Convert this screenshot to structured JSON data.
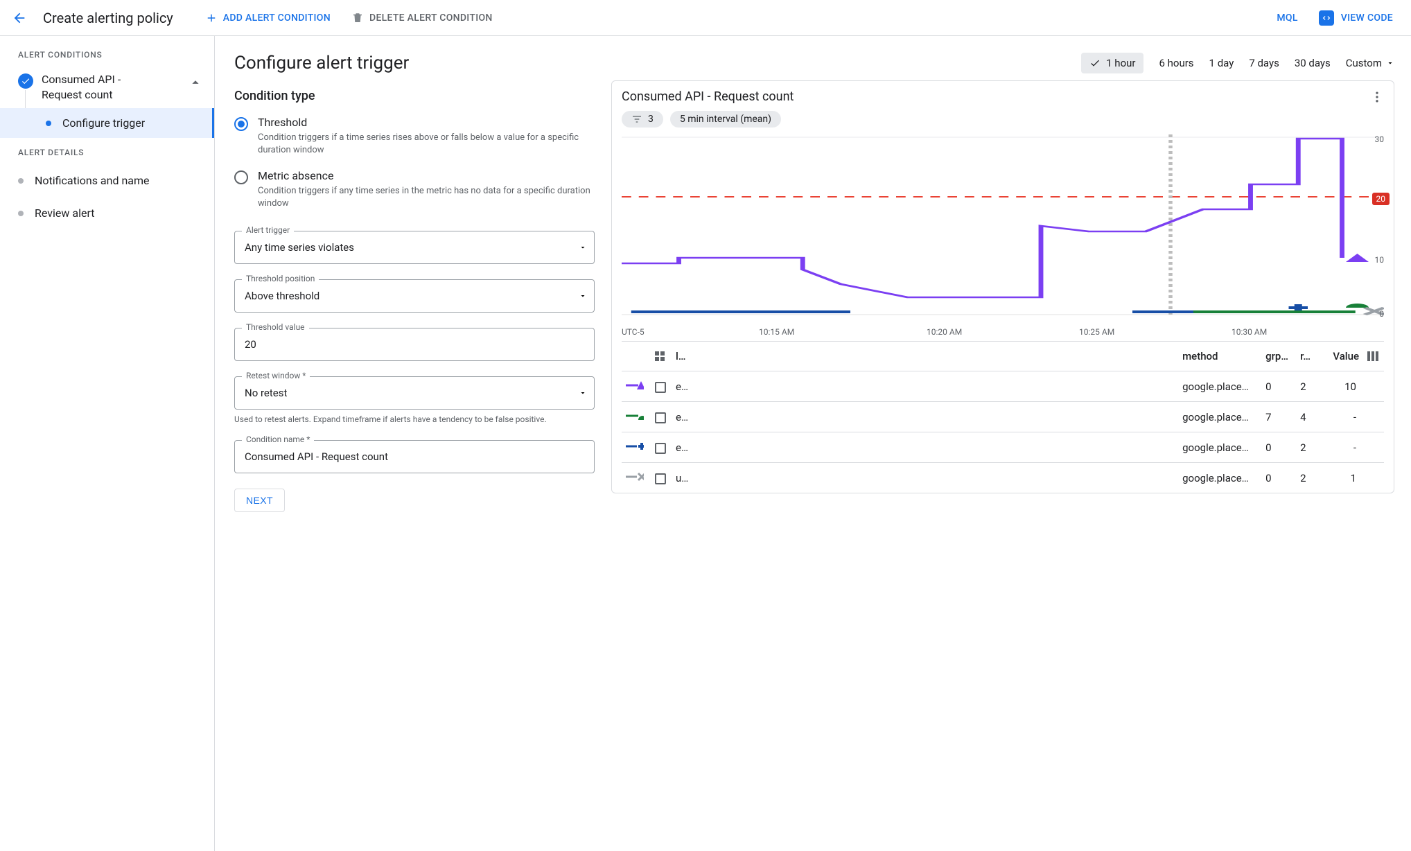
{
  "topbar": {
    "title": "Create alerting policy",
    "add_condition": "ADD ALERT CONDITION",
    "delete_condition": "DELETE ALERT CONDITION",
    "mql": "MQL",
    "view_code": "VIEW CODE"
  },
  "sidebar": {
    "section_conditions": "ALERT CONDITIONS",
    "condition_title_l1": "Consumed API -",
    "condition_title_l2": "Request count",
    "substep": "Configure trigger",
    "section_details": "ALERT DETAILS",
    "detail_notifications": "Notifications and name",
    "detail_review": "Review alert"
  },
  "form": {
    "heading": "Configure alert trigger",
    "cond_type_label": "Condition type",
    "threshold_title": "Threshold",
    "threshold_desc": "Condition triggers if a time series rises above or falls below a value for a specific duration window",
    "absence_title": "Metric absence",
    "absence_desc": "Condition triggers if any time series in the metric has no data for a specific duration window",
    "alert_trigger_label": "Alert trigger",
    "alert_trigger_value": "Any time series violates",
    "threshold_position_label": "Threshold position",
    "threshold_position_value": "Above threshold",
    "threshold_value_label": "Threshold value",
    "threshold_value_value": "20",
    "retest_label": "Retest window *",
    "retest_value": "No retest",
    "retest_helper": "Used to retest alerts. Expand timeframe if alerts have a tendency to be false positive.",
    "cond_name_label": "Condition name *",
    "cond_name_value": "Consumed API - Request count",
    "next": "NEXT"
  },
  "timerange": {
    "selected": "1 hour",
    "r2": "6 hours",
    "r3": "1 day",
    "r4": "7 days",
    "r5": "30 days",
    "custom": "Custom"
  },
  "card": {
    "title": "Consumed API - Request count",
    "filter_count": "3",
    "interval_chip": "5 min interval (mean)",
    "threshold_value": "20",
    "y30": "30",
    "y20": "20",
    "y10": "10",
    "y0": "0",
    "tz": "UTC-5",
    "x1": "10:15 AM",
    "x2": "10:20 AM",
    "x3": "10:25 AM",
    "x4": "10:30 AM"
  },
  "table": {
    "col_l": "l…",
    "col_method": "method",
    "col_grp": "grp…",
    "col_r": "r…",
    "col_value": "Value",
    "rows": [
      {
        "mark": "purple-tri",
        "l": "e…",
        "method": "google.place…",
        "grp": "0",
        "r": "2",
        "value": "10"
      },
      {
        "mark": "green-semi",
        "l": "e…",
        "method": "google.place…",
        "grp": "7",
        "r": "4",
        "value": "-"
      },
      {
        "mark": "blue-plus",
        "l": "e…",
        "method": "google.place…",
        "grp": "0",
        "r": "2",
        "value": "-"
      },
      {
        "mark": "grey-x",
        "l": "u…",
        "method": "google.place…",
        "grp": "0",
        "r": "2",
        "value": "1"
      }
    ]
  },
  "chart_data": {
    "type": "line",
    "title": "Consumed API - Request count",
    "ylabel": "",
    "ylim": [
      0,
      30
    ],
    "threshold": 20,
    "x": [
      "10:10",
      "10:11",
      "10:12",
      "10:13",
      "10:14",
      "10:15",
      "10:16",
      "10:17",
      "10:18",
      "10:19",
      "10:20",
      "10:21",
      "10:22",
      "10:23",
      "10:24",
      "10:25",
      "10:26",
      "10:27",
      "10:28",
      "10:29",
      "10:30",
      "10:31"
    ],
    "series": [
      {
        "name": "e… google.place… (purple)",
        "values": [
          9,
          9,
          10,
          10,
          10,
          8,
          5,
          3,
          3,
          3,
          3,
          3,
          15,
          14,
          14,
          14,
          14,
          18,
          18,
          22,
          30,
          10
        ]
      },
      {
        "name": "e… google.place… (green)",
        "values": [
          null,
          null,
          null,
          null,
          null,
          null,
          null,
          null,
          null,
          null,
          null,
          null,
          null,
          null,
          null,
          0,
          0,
          0,
          0,
          0,
          0,
          null
        ]
      },
      {
        "name": "e… google.place… (blue)",
        "values": [
          0,
          0,
          0,
          0,
          0,
          0,
          0,
          0,
          null,
          null,
          null,
          null,
          null,
          null,
          null,
          0,
          0,
          0,
          0,
          0,
          null,
          null
        ]
      },
      {
        "name": "u… google.place… (grey)",
        "values": [
          null,
          null,
          null,
          null,
          null,
          null,
          null,
          null,
          null,
          null,
          null,
          null,
          null,
          null,
          null,
          null,
          null,
          null,
          null,
          null,
          0,
          0
        ]
      }
    ]
  }
}
